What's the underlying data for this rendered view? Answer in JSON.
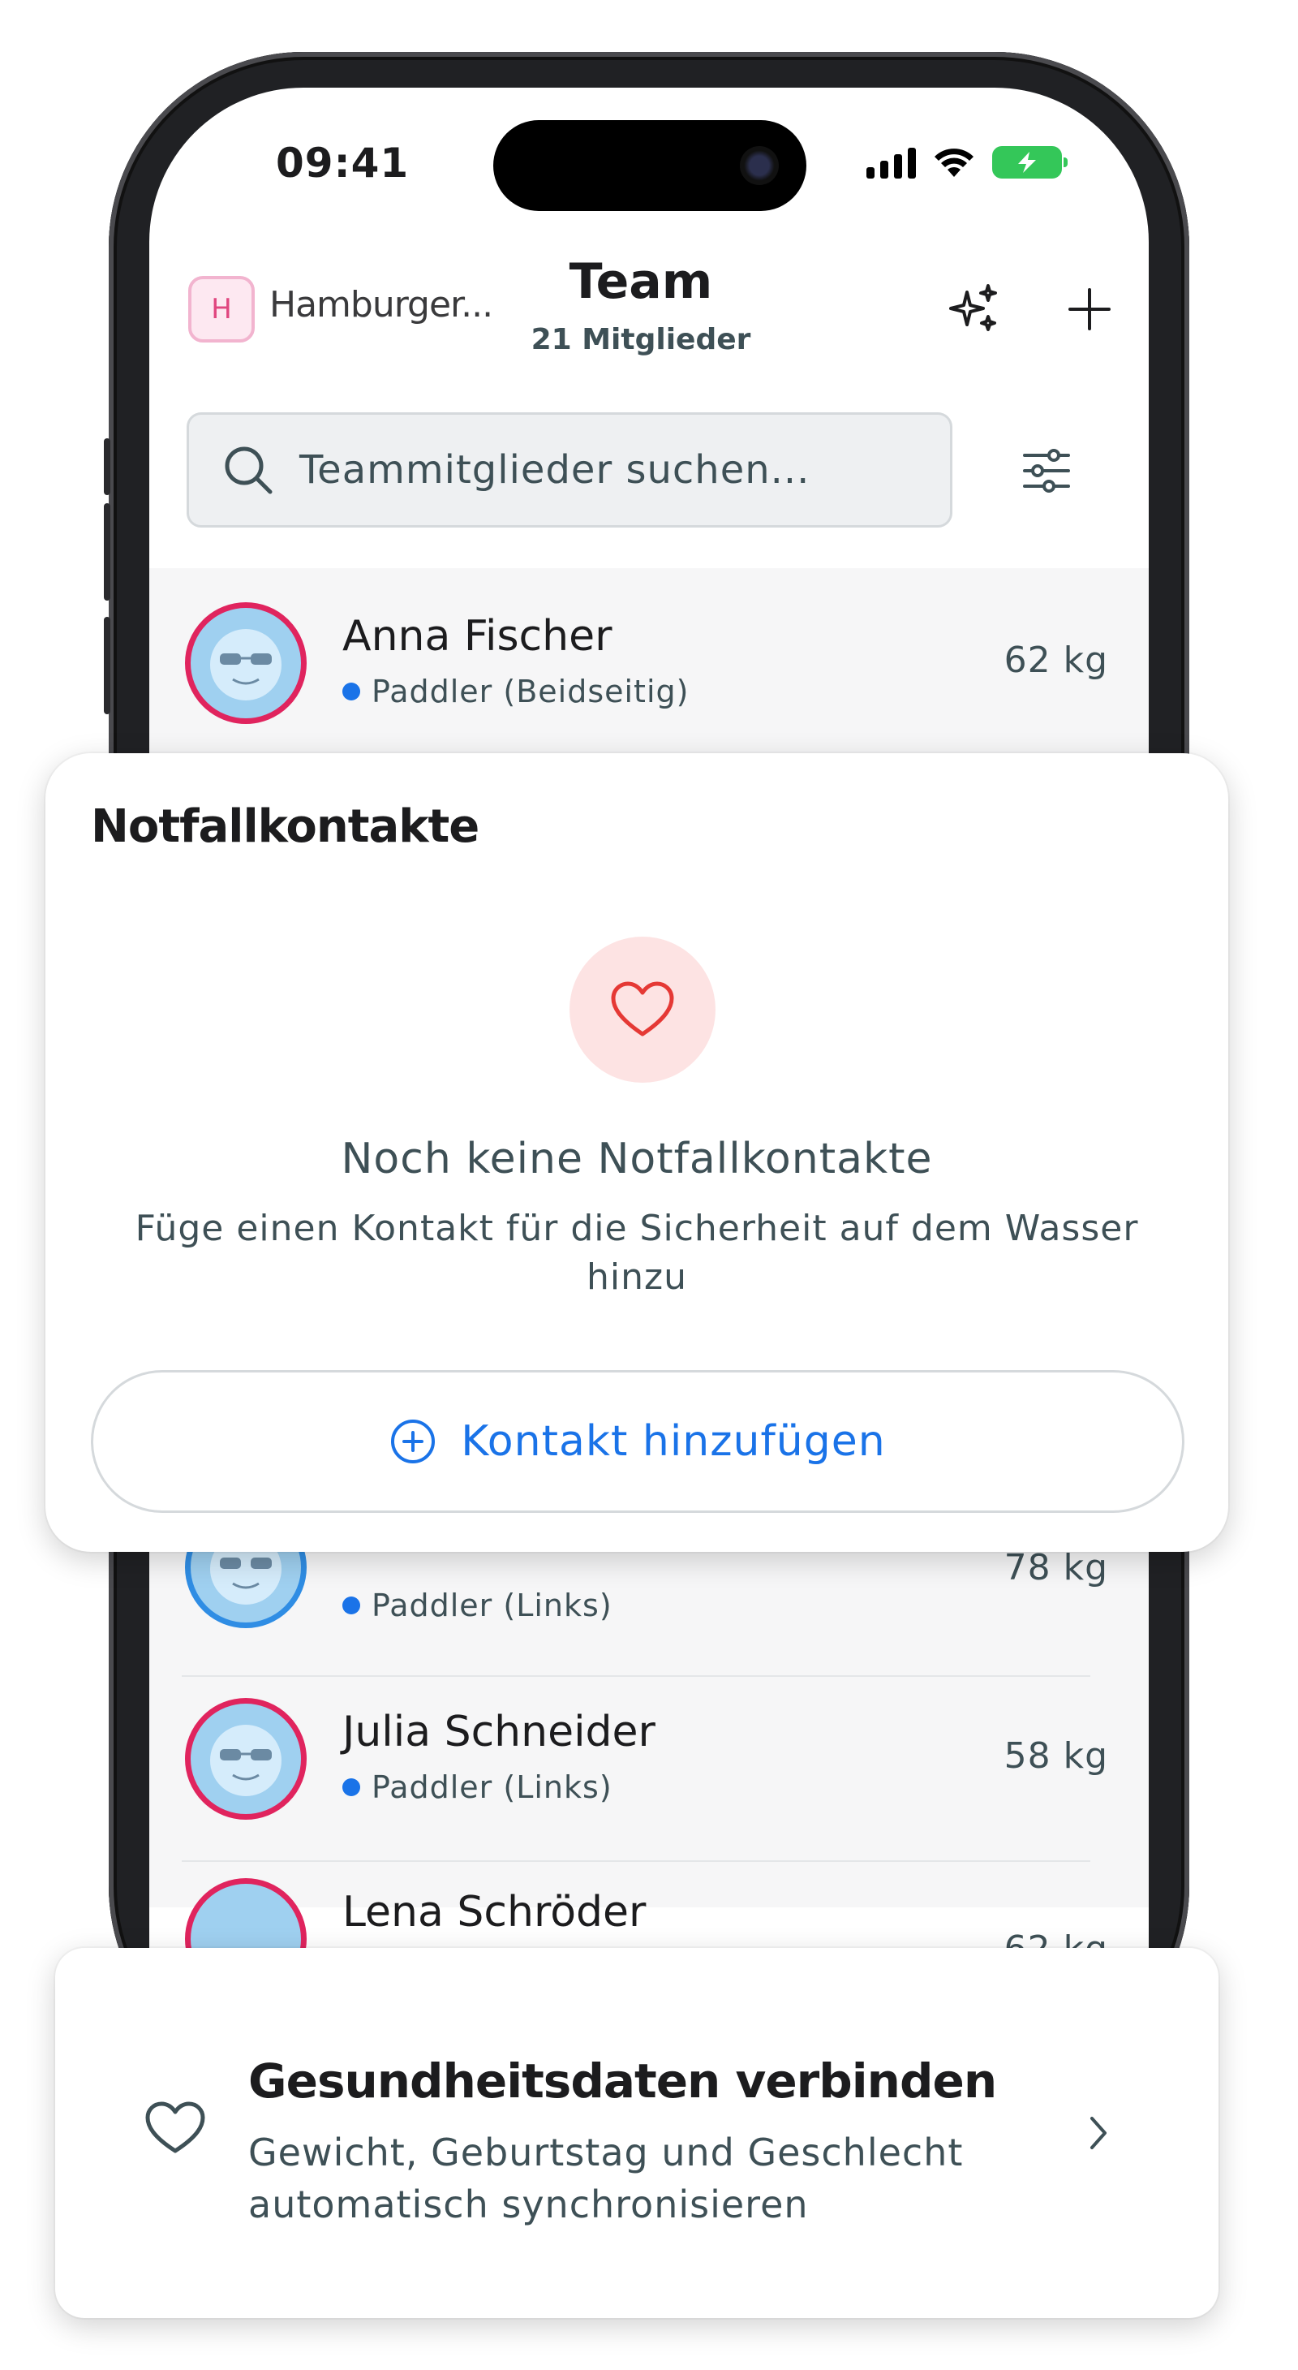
{
  "status_bar": {
    "time": "09:41"
  },
  "header": {
    "team_initial": "H",
    "team_name": "Hamburger...",
    "title": "Team",
    "member_count": "21 Mitglieder"
  },
  "search": {
    "placeholder": "Teammitglieder suchen..."
  },
  "members": [
    {
      "name": "Anna Fischer",
      "role": "Paddler (Beidseitig)",
      "weight": "62 kg"
    },
    {
      "name": "",
      "role": "Paddler (Links)",
      "weight": "78 kg"
    },
    {
      "name": "Julia Schneider",
      "role": "Paddler (Links)",
      "weight": "58 kg"
    },
    {
      "name": "Lena Schröder",
      "role": "",
      "weight": "62 kg"
    }
  ],
  "emergency_card": {
    "title": "Notfallkontakte",
    "empty_title": "Noch keine Notfallkontakte",
    "empty_subtitle": "Füge einen Kontakt für die Sicherheit auf dem Wasser hinzu",
    "add_button": "Kontakt hinzufügen"
  },
  "health_card": {
    "title": "Gesundheitsdaten verbinden",
    "subtitle": "Gewicht, Geburtstag und Geschlecht automatisch synchronisieren"
  },
  "colors": {
    "accent_blue": "#1a73e8",
    "avatar_border_pink": "#e0245e",
    "avatar_border_blue": "#2f8de4",
    "heart_red": "#e53935",
    "battery_green": "#34c759",
    "text_muted": "#3e5056"
  },
  "icons": {
    "header": [
      "sparkles-icon",
      "plus-icon"
    ],
    "search": "search-icon",
    "filter": "sliders-icon",
    "emergency": "heart-icon",
    "add": "plus-circle-icon",
    "health": "heart-outline-icon",
    "health_chevron": "chevron-right-icon"
  }
}
